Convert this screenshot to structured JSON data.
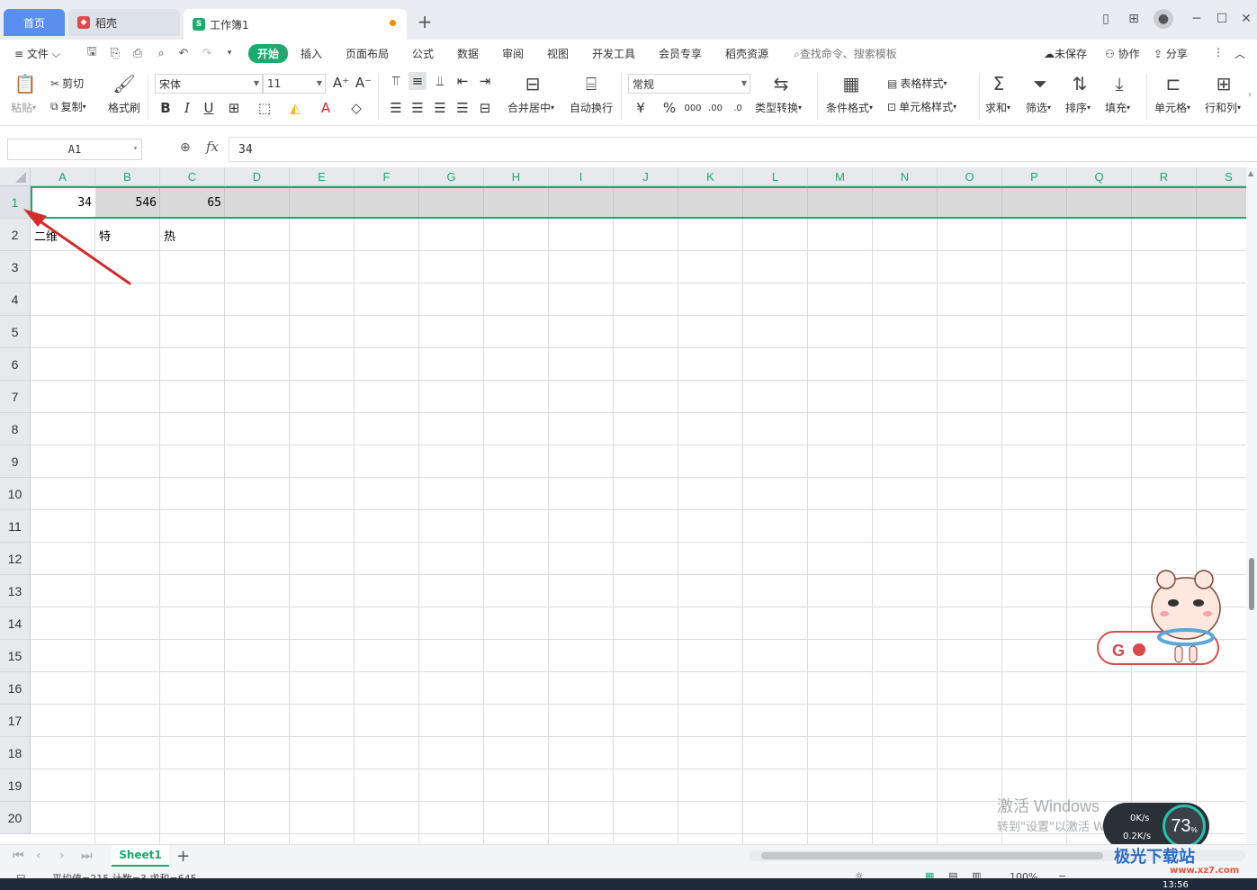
{
  "tabs": {
    "home": "首页",
    "docer": "稻壳",
    "workbook": "工作簿1"
  },
  "menu": {
    "file": "文件",
    "items": [
      "开始",
      "插入",
      "页面布局",
      "公式",
      "数据",
      "审阅",
      "视图",
      "开发工具",
      "会员专享",
      "稻壳资源"
    ],
    "search_placeholder": "查找命令、搜索模板",
    "unsaved": "未保存",
    "collab": "协作",
    "share": "分享"
  },
  "ribbon": {
    "paste": "粘贴",
    "cut": "剪切",
    "copy": "复制",
    "format_painter": "格式刷",
    "font_name": "宋体",
    "font_size": "11",
    "merge_center": "合并居中",
    "wrap_text": "自动换行",
    "number_format": "常规",
    "type_convert": "类型转换",
    "cond_format": "条件格式",
    "table_style": "表格样式",
    "cell_style": "单元格样式",
    "sum": "求和",
    "filter": "筛选",
    "sort": "排序",
    "fill": "填充",
    "cell": "单元格",
    "row_col": "行和列"
  },
  "formula_bar": {
    "name_box": "A1",
    "fx": "fx",
    "value": "34"
  },
  "grid": {
    "columns": [
      "A",
      "B",
      "C",
      "D",
      "E",
      "F",
      "G",
      "H",
      "I",
      "J",
      "K",
      "L",
      "M",
      "N",
      "O",
      "P",
      "Q",
      "R",
      "S"
    ],
    "rows": [
      "1",
      "2",
      "3",
      "4",
      "5",
      "6",
      "7",
      "8",
      "9",
      "10",
      "11",
      "12",
      "13",
      "14",
      "15",
      "16",
      "17",
      "18",
      "19",
      "20"
    ],
    "cells": {
      "A1": "34",
      "B1": "546",
      "C1": "65",
      "A2": "二维",
      "B2": "特",
      "C2": "热"
    }
  },
  "sheets": [
    "Sheet1"
  ],
  "status": {
    "summary": "平均值=215  计数=3  求和=645",
    "zoom": "100%"
  },
  "watermark": {
    "line1": "激活 Windows",
    "line2": "转到\"设置\"以激活 Windows。"
  },
  "netmon": {
    "up": "0K/s",
    "down": "0.2K/s",
    "percent": "73",
    "percent_unit": "%"
  },
  "clock": "13:56",
  "site": {
    "logo": "极光下载站",
    "url": "www.xz7.com"
  },
  "colors": {
    "accent": "#1aab6d",
    "home_tab": "#5a8ff0",
    "arrow": "#d42a2a"
  }
}
